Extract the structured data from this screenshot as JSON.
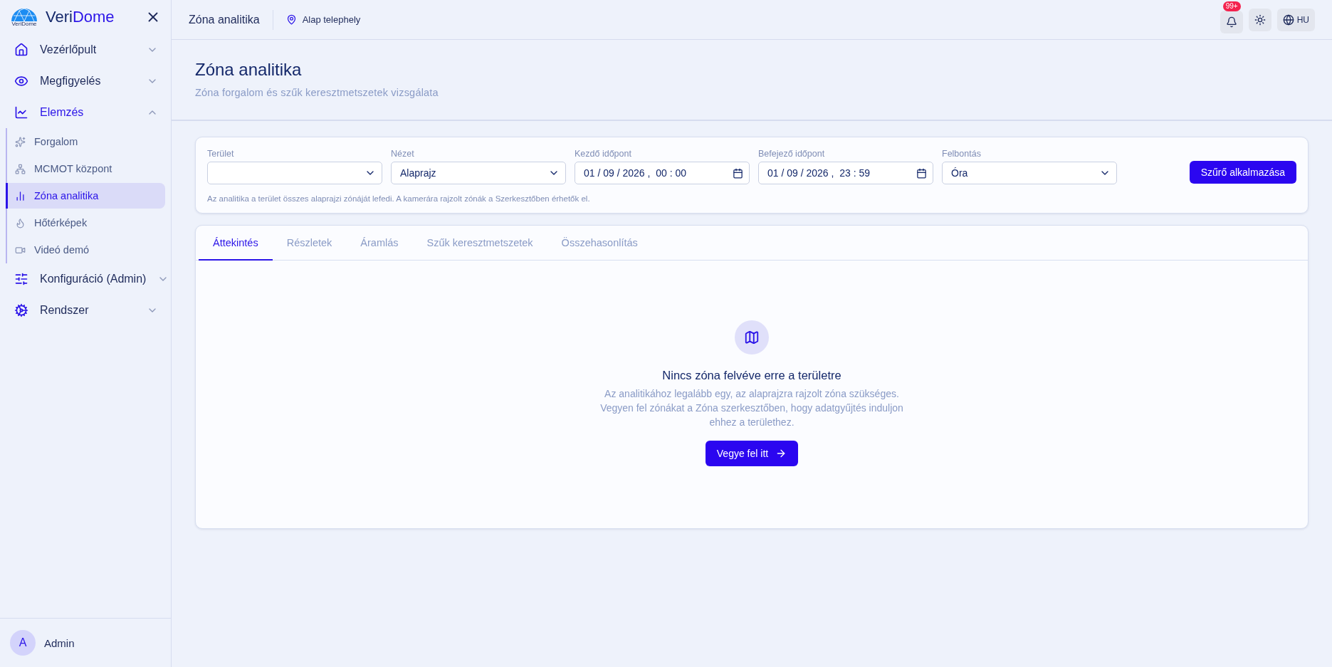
{
  "sidebar": {
    "brand": {
      "first": "Veri",
      "second": "Dome",
      "logo_caption": "VeriDome"
    },
    "sections": [
      {
        "label": "Vezérlőpult",
        "expanded": false,
        "active": false
      },
      {
        "label": "Megfigyelés",
        "expanded": false,
        "active": false
      },
      {
        "label": "Elemzés",
        "expanded": true,
        "active": true,
        "children": [
          {
            "label": "Forgalom",
            "selected": false
          },
          {
            "label": "MCMOT központ",
            "selected": false
          },
          {
            "label": "Zóna analitika",
            "selected": true
          },
          {
            "label": "Hőtérképek",
            "selected": false
          },
          {
            "label": "Videó demó",
            "selected": false
          }
        ]
      },
      {
        "label": "Konfiguráció (Admin)",
        "expanded": false,
        "active": false
      },
      {
        "label": "Rendszer",
        "expanded": false,
        "active": false
      }
    ],
    "user": {
      "initial": "A",
      "name": "Admin"
    }
  },
  "topbar": {
    "title": "Zóna analitika",
    "site": "Alap telephely",
    "notification_count": "99+",
    "language": "HU"
  },
  "page": {
    "title": "Zóna analitika",
    "subtitle": "Zóna forgalom és szűk keresztmetszetek vizsgálata"
  },
  "filters": {
    "fields": [
      {
        "kind": "select",
        "label": "Terület"
      },
      {
        "kind": "select",
        "label": "Nézet",
        "value": "Alaprajz"
      },
      {
        "kind": "datetime",
        "label": "Kezdő időpont",
        "value": "01 / 09 / 2026 ,  00 : 00"
      },
      {
        "kind": "datetime",
        "label": "Befejező időpont",
        "value": "01 / 09 / 2026 ,  23 : 59"
      },
      {
        "kind": "select",
        "label": "Felbontás",
        "value": "Óra"
      }
    ],
    "apply": "Szűrő alkalmazása",
    "note": "Az analitika a terület összes alaprajzi zónáját lefedi. A kamerára rajzolt zónák a Szerkesztőben érhetők el."
  },
  "tabs": [
    {
      "label": "Áttekintés",
      "selected": true
    },
    {
      "label": "Részletek",
      "selected": false
    },
    {
      "label": "Áramlás",
      "selected": false
    },
    {
      "label": "Szűk keresztmetszetek",
      "selected": false
    },
    {
      "label": "Összehasonlítás",
      "selected": false
    }
  ],
  "empty_state": {
    "title": "Nincs zóna felvéve erre a területre",
    "message": "Az analitikához legalább egy, az alaprajzra rajzolt zóna szükséges. Vegyen fel zónákat a Zóna szerkesztőben, hogy adatgyűjtés induljon ehhez a területhez.",
    "action": "Vegye fel itt"
  }
}
